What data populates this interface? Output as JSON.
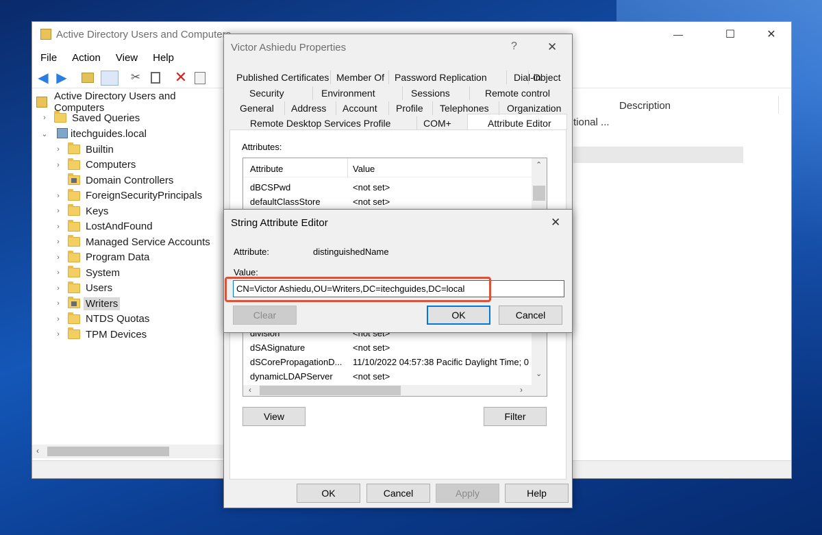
{
  "colors": {
    "accent": "#0078d7",
    "highlight_box": "#d9533c",
    "desktop": "#1457b8"
  },
  "aduc": {
    "title": "Active Directory Users and Computers",
    "menu": [
      "File",
      "Action",
      "View",
      "Help"
    ],
    "toolbar_icons": [
      "back-arrow-icon",
      "forward-arrow-icon",
      "up-folder-icon",
      "console-tree-icon",
      "cut-icon",
      "clipboard-icon",
      "delete-icon",
      "properties-icon"
    ],
    "tree": {
      "root": "Active Directory Users and Computers",
      "saved_queries": "Saved Queries",
      "domain": "itechguides.local",
      "children": [
        "Builtin",
        "Computers",
        "Domain Controllers",
        "ForeignSecurityPrincipals",
        "Keys",
        "LostAndFound",
        "Managed Service Accounts",
        "Program Data",
        "System",
        "Users",
        "Writers",
        "NTDS Quotas",
        "TPM Devices"
      ],
      "selected": "Writers"
    },
    "list": {
      "column_description": "Description",
      "row_snippet": "tional ..."
    },
    "window_controls": {
      "minimize": "—",
      "maximize": "☐",
      "close": "✕"
    }
  },
  "props": {
    "title": "Victor Ashiedu Properties",
    "help": "?",
    "close": "✕",
    "tabs_row1": [
      "Published Certificates",
      "Member Of",
      "Password Replication",
      "Dial-in",
      "Object"
    ],
    "tabs_row2": [
      "Security",
      "Environment",
      "Sessions",
      "Remote control"
    ],
    "tabs_row3": [
      "General",
      "Address",
      "Account",
      "Profile",
      "Telephones",
      "Organization"
    ],
    "tabs_row4": [
      "Remote Desktop Services Profile",
      "COM+",
      "Attribute Editor"
    ],
    "attributes_label": "Attributes:",
    "col_attribute": "Attribute",
    "col_value": "Value",
    "rows_top": [
      {
        "k": "dBCSPwd",
        "v": "<not set>"
      },
      {
        "k": "defaultClassStore",
        "v": "<not set>"
      }
    ],
    "rows_bottom": [
      {
        "k": "division",
        "v": "<not set>"
      },
      {
        "k": "dSASignature",
        "v": "<not set>"
      },
      {
        "k": "dSCorePropagationD...",
        "v": "11/10/2022 04:57:38 Pacific Daylight Time; 0"
      },
      {
        "k": "dynamicLDAPServer",
        "v": "<not set>"
      }
    ],
    "view": "View",
    "filter": "Filter",
    "ok": "OK",
    "cancel": "Cancel",
    "apply": "Apply",
    "help_btn": "Help"
  },
  "editor": {
    "title": "String Attribute Editor",
    "close": "✕",
    "attribute_label": "Attribute:",
    "attribute_value": "distinguishedName",
    "value_label": "Value:",
    "value": "CN=Victor Ashiedu,OU=Writers,DC=itechguides,DC=local",
    "clear": "Clear",
    "ok": "OK",
    "cancel": "Cancel"
  }
}
